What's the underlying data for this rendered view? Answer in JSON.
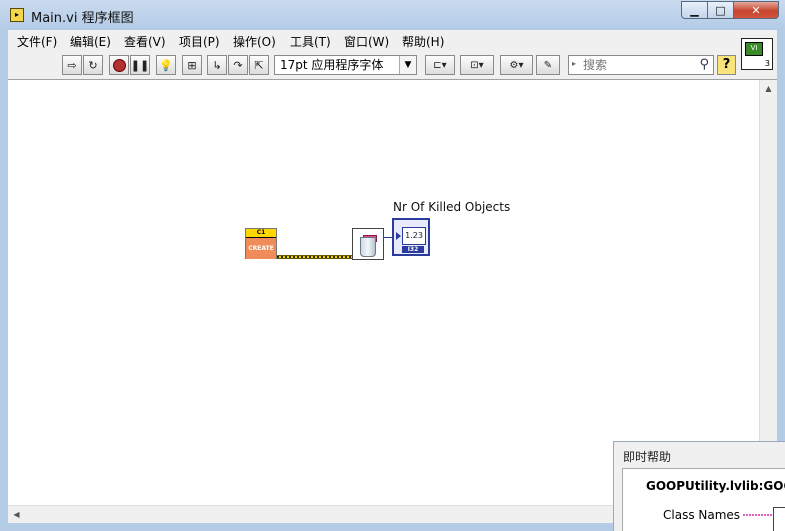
{
  "window": {
    "title": "Main.vi 程序框图",
    "minimize_glyph": "▁",
    "maximize_glyph": "□",
    "close_glyph": "✕"
  },
  "menu": [
    {
      "label": "文件(F)"
    },
    {
      "label": "编辑(E)"
    },
    {
      "label": "查看(V)"
    },
    {
      "label": "项目(P)"
    },
    {
      "label": "操作(O)"
    },
    {
      "label": "工具(T)"
    },
    {
      "label": "窗口(W)"
    },
    {
      "label": "帮助(H)"
    }
  ],
  "toolbar": {
    "font_selector": "17pt 应用程序字体",
    "search_placeholder": "搜索",
    "help_label": "?"
  },
  "vi_icon": {
    "connector_count": "3"
  },
  "diagram": {
    "create_node_top": "C1",
    "create_node_label": "CREATE",
    "indicator_label": "Nr Of Killed Objects",
    "indicator_display": "1.23",
    "indicator_type": "I32",
    "wire_color": "#f2d400"
  },
  "context_help": {
    "title": "即时帮助",
    "vi_name": "GOOPUtility.lvlib:GOOP",
    "terminal_label": "Class Names"
  }
}
